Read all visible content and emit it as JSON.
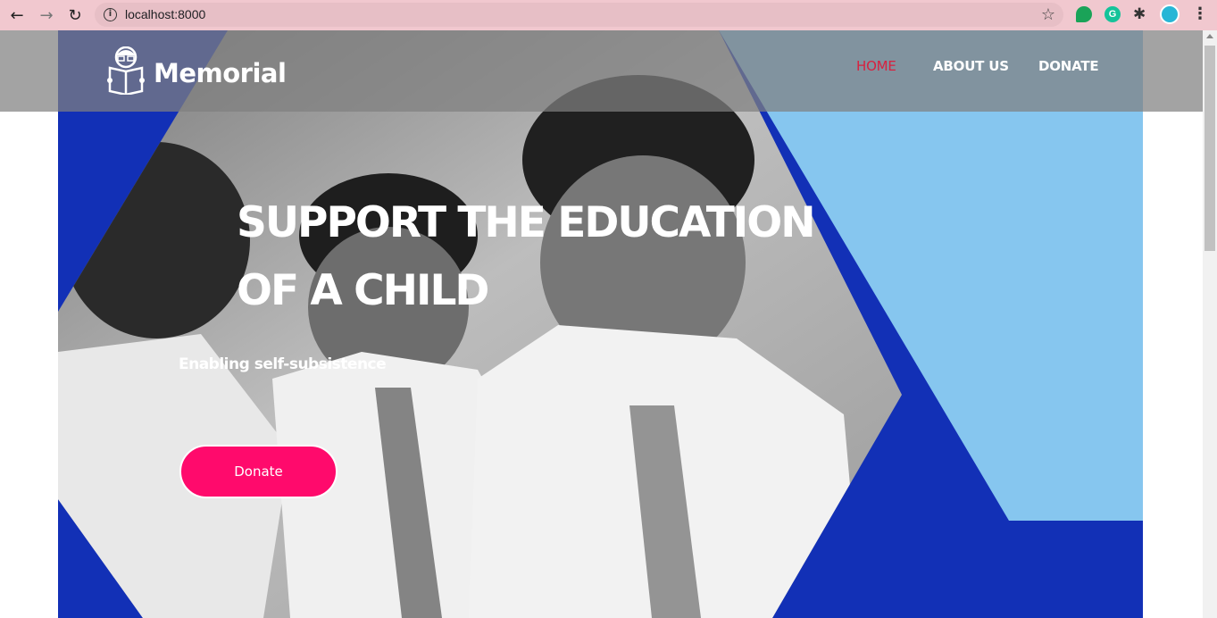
{
  "browser": {
    "url": "localhost:8000",
    "back_icon": "back-arrow-icon",
    "forward_icon": "forward-arrow-icon",
    "reload_icon": "reload-icon",
    "extensions": [
      "chat-extension-icon",
      "grammarly-icon",
      "puzzle-icon",
      "profile-avatar"
    ]
  },
  "header": {
    "logo_text": "Memorial",
    "nav": [
      {
        "label": "HOME",
        "active": true
      },
      {
        "label": "ABOUT US",
        "active": false
      },
      {
        "label": "DONATE",
        "active": false
      }
    ]
  },
  "hero": {
    "headline_line1": "SUPPORT THE EDUCATION",
    "headline_line2": "OF A CHILD",
    "subline": "Enabling self-subsistence",
    "cta_label": "Donate"
  },
  "colors": {
    "hero_blue": "#1230b6",
    "light_blue": "#86c6ef",
    "cta_pink": "#ff0a6c",
    "nav_active": "#d8213f",
    "chrome_pink": "#f1c8cf"
  }
}
